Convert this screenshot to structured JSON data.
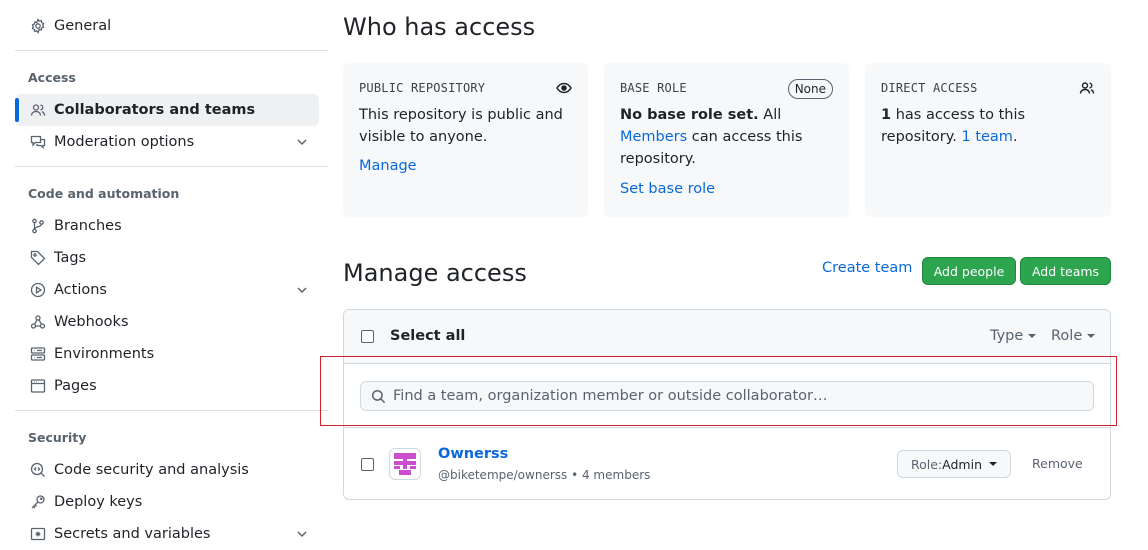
{
  "sidebar": {
    "general": "General",
    "access_title": "Access",
    "collaborators": "Collaborators and teams",
    "moderation": "Moderation options",
    "code_title": "Code and automation",
    "branches": "Branches",
    "tags": "Tags",
    "actions": "Actions",
    "webhooks": "Webhooks",
    "environments": "Environments",
    "pages": "Pages",
    "security_title": "Security",
    "code_security": "Code security and analysis",
    "deploy_keys": "Deploy keys",
    "secrets": "Secrets and variables"
  },
  "who": {
    "title": "Who has access",
    "public_label": "PUBLIC REPOSITORY",
    "public_text_1": "This repository is public and",
    "public_text_2": "visible to anyone.",
    "manage": "Manage",
    "base_label": "BASE ROLE",
    "base_badge": "None",
    "base_bold": "No base role set.",
    "base_text_1": " All",
    "base_members": "Members",
    "base_text_2": " can access this",
    "base_text_3": "repository.",
    "set_base": "Set base role",
    "direct_label": "DIRECT ACCESS",
    "direct_count": "1",
    "direct_text_1": " has access to this",
    "direct_text_2": "repository. ",
    "direct_team": "1 team",
    "direct_period": "."
  },
  "manage": {
    "title": "Manage access",
    "create_team": "Create team",
    "add_people": "Add people",
    "add_teams": "Add teams",
    "select_all": "Select all",
    "type_filter": "Type",
    "role_filter": "Role",
    "search_placeholder": "Find a team, organization member or outside collaborator…",
    "row": {
      "name": "Ownerss",
      "handle": "@biketempe/ownerss",
      "sep": " • ",
      "members": "4 members",
      "role_prefix": "Role: ",
      "role_value": "Admin",
      "remove": "Remove"
    }
  },
  "colors": {
    "accent": "#0969da",
    "green": "#2da44e",
    "avatar": "#c94fd0",
    "highlight": "#cf222e"
  }
}
